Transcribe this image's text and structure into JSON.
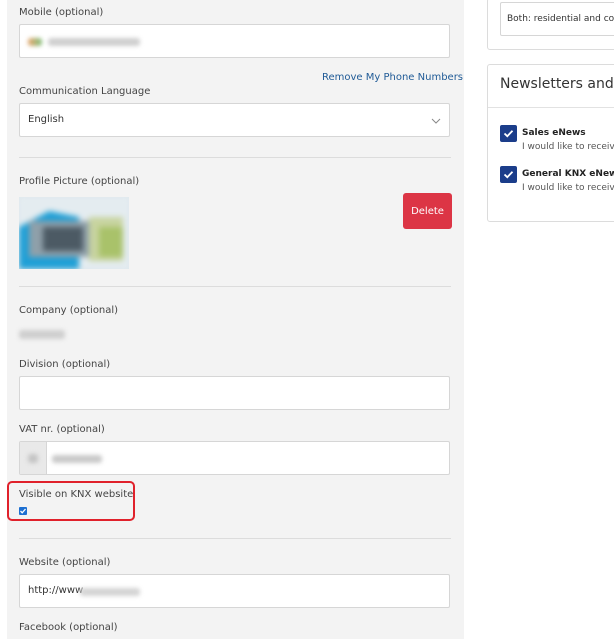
{
  "profile": {
    "mobile_label": "Mobile (optional)",
    "remove_phone_link": "Remove My Phone Numbers",
    "communication_language_label": "Communication Language",
    "communication_language_value": "English",
    "profile_picture_label": "Profile Picture (optional)",
    "delete_button": "Delete",
    "company_label": "Company (optional)",
    "division_label": "Division (optional)",
    "division_value": "",
    "vat_label": "VAT nr. (optional)",
    "visible_label": "Visible on KNX website",
    "visible_checked": true,
    "website_label": "Website (optional)",
    "website_value": "http://www",
    "facebook_label": "Facebook (optional)"
  },
  "sidebar": {
    "segment_value": "Both: residential and co",
    "newsletters_title": "Newsletters and U",
    "newsletters": [
      {
        "title": "Sales eNews",
        "desc": "I would like to receiv",
        "checked": true
      },
      {
        "title": "General KNX eNews",
        "desc": "I would like to receiv",
        "checked": true
      }
    ]
  },
  "colors": {
    "delete_button": "#dc3545",
    "highlight": "#e0212b",
    "checkbox_blue": "#1b3d8a",
    "link": "#1f5a96"
  }
}
